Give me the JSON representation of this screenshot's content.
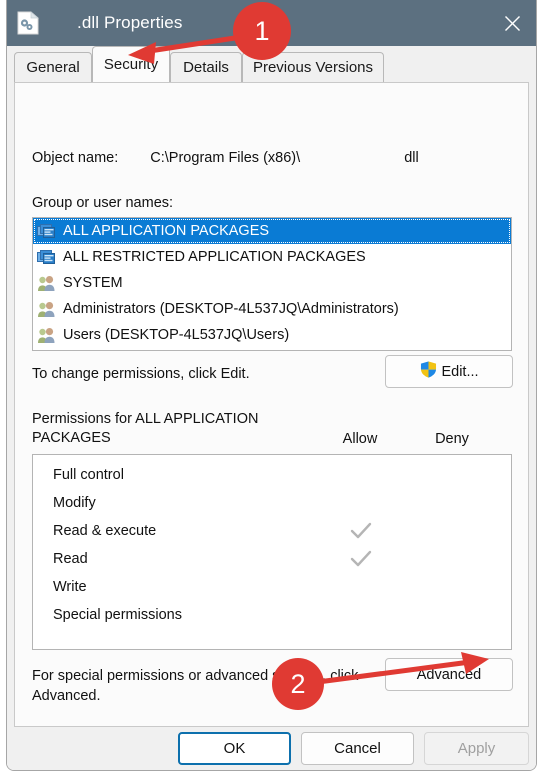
{
  "window": {
    "title": ".dll Properties",
    "icon": "dll-file-icon",
    "close_icon": "close-icon",
    "titlebar_color": "#5c7080"
  },
  "tabs": [
    {
      "label": "General",
      "active": false
    },
    {
      "label": "Security",
      "active": true
    },
    {
      "label": "Details",
      "active": false
    },
    {
      "label": "Previous Versions",
      "active": false
    }
  ],
  "object_name": {
    "label": "Object name:",
    "value": "C:\\Program Files (x86)\\",
    "suffix": "dll"
  },
  "group_section": {
    "label": "Group or user names:",
    "items": [
      {
        "name": "ALL APPLICATION PACKAGES",
        "icon": "app-packages-icon",
        "selected": true
      },
      {
        "name": "ALL RESTRICTED APPLICATION PACKAGES",
        "icon": "app-packages-icon",
        "selected": false
      },
      {
        "name": "SYSTEM",
        "icon": "users-icon",
        "selected": false
      },
      {
        "name": "Administrators (DESKTOP-4L537JQ\\Administrators)",
        "icon": "users-icon",
        "selected": false
      },
      {
        "name": "Users (DESKTOP-4L537JQ\\Users)",
        "icon": "users-icon",
        "selected": false
      }
    ],
    "selection_color": "#0a7bd4"
  },
  "change_permissions": {
    "hint": "To change permissions, click Edit.",
    "edit_label": "Edit...",
    "edit_icon": "uac-shield-icon"
  },
  "permissions_section": {
    "header": "Permissions for ALL APPLICATION PACKAGES",
    "allow_header": "Allow",
    "deny_header": "Deny",
    "rows": [
      {
        "label": "Full control",
        "allow": false,
        "deny": false
      },
      {
        "label": "Modify",
        "allow": false,
        "deny": false
      },
      {
        "label": "Read & execute",
        "allow": true,
        "deny": false
      },
      {
        "label": "Read",
        "allow": true,
        "deny": false
      },
      {
        "label": "Write",
        "allow": false,
        "deny": false
      },
      {
        "label": "Special permissions",
        "allow": false,
        "deny": false
      }
    ],
    "check_color": "#b0b0b0"
  },
  "advanced_section": {
    "hint": "For special permissions or advanced settings, click Advanced.",
    "button_label": "Advanced"
  },
  "footer": {
    "ok_label": "OK",
    "cancel_label": "Cancel",
    "apply_label": "Apply",
    "apply_disabled": true
  },
  "annotations": [
    {
      "number": "1",
      "color": "#e03a33",
      "points_to": "security-tab"
    },
    {
      "number": "2",
      "color": "#e03a33",
      "points_to": "advanced-button"
    }
  ]
}
